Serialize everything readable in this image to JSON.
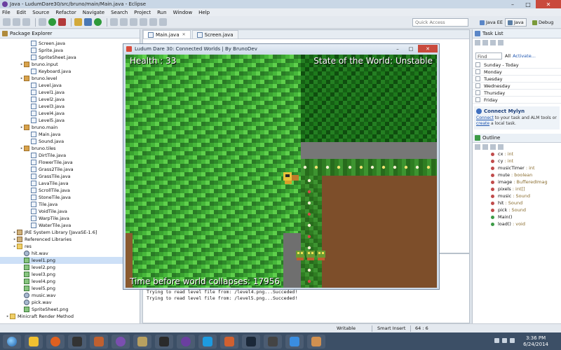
{
  "window": {
    "title": "Java - LudumDare30/src/bruno/main/Main.java - Eclipse"
  },
  "menu": [
    "File",
    "Edit",
    "Source",
    "Refactor",
    "Navigate",
    "Search",
    "Project",
    "Run",
    "Window",
    "Help"
  ],
  "toolbar": {
    "quick_access_placeholder": "Quick Access"
  },
  "perspectives": [
    {
      "label": "Java EE",
      "active": false
    },
    {
      "label": "Java",
      "active": true
    },
    {
      "label": "Debug",
      "active": false
    }
  ],
  "package_explorer": {
    "title": "Package Explorer",
    "items": [
      {
        "label": "Screen.java",
        "indent": 3,
        "icon": "java-file"
      },
      {
        "label": "Sprite.java",
        "indent": 3,
        "icon": "java-file"
      },
      {
        "label": "SpriteSheet.java",
        "indent": 3,
        "icon": "java-file"
      },
      {
        "label": "bruno.input",
        "indent": 2,
        "icon": "package"
      },
      {
        "label": "Keyboard.java",
        "indent": 3,
        "icon": "java-file"
      },
      {
        "label": "bruno.level",
        "indent": 2,
        "icon": "package"
      },
      {
        "label": "Level.java",
        "indent": 3,
        "icon": "java-file"
      },
      {
        "label": "Level1.java",
        "indent": 3,
        "icon": "java-file"
      },
      {
        "label": "Level2.java",
        "indent": 3,
        "icon": "java-file"
      },
      {
        "label": "Level3.java",
        "indent": 3,
        "icon": "java-file"
      },
      {
        "label": "Level4.java",
        "indent": 3,
        "icon": "java-file"
      },
      {
        "label": "Level5.java",
        "indent": 3,
        "icon": "java-file"
      },
      {
        "label": "bruno.main",
        "indent": 2,
        "icon": "package"
      },
      {
        "label": "Main.java",
        "indent": 3,
        "icon": "java-file"
      },
      {
        "label": "Sound.java",
        "indent": 3,
        "icon": "java-file"
      },
      {
        "label": "bruno.tiles",
        "indent": 2,
        "icon": "package"
      },
      {
        "label": "DirtTile.java",
        "indent": 3,
        "icon": "java-file"
      },
      {
        "label": "FlowerTile.java",
        "indent": 3,
        "icon": "java-file"
      },
      {
        "label": "Grass2Tile.java",
        "indent": 3,
        "icon": "java-file"
      },
      {
        "label": "GrassTile.java",
        "indent": 3,
        "icon": "java-file"
      },
      {
        "label": "LavaTile.java",
        "indent": 3,
        "icon": "java-file"
      },
      {
        "label": "ScrollTile.java",
        "indent": 3,
        "icon": "java-file"
      },
      {
        "label": "StoneTile.java",
        "indent": 3,
        "icon": "java-file"
      },
      {
        "label": "Tile.java",
        "indent": 3,
        "icon": "java-file"
      },
      {
        "label": "VoidTile.java",
        "indent": 3,
        "icon": "java-file"
      },
      {
        "label": "WarpTile.java",
        "indent": 3,
        "icon": "java-file"
      },
      {
        "label": "WaterTile.java",
        "indent": 3,
        "icon": "java-file"
      },
      {
        "label": "JRE System Library [JavaSE-1.6]",
        "indent": 1,
        "icon": "library"
      },
      {
        "label": "Referenced Libraries",
        "indent": 1,
        "icon": "library"
      },
      {
        "label": "res",
        "indent": 1,
        "icon": "folder"
      },
      {
        "label": "hit.wav",
        "indent": 2,
        "icon": "sound-file"
      },
      {
        "label": "level1.png",
        "indent": 2,
        "icon": "image-file"
      },
      {
        "label": "level2.png",
        "indent": 2,
        "icon": "image-file"
      },
      {
        "label": "level3.png",
        "indent": 2,
        "icon": "image-file"
      },
      {
        "label": "level4.png",
        "indent": 2,
        "icon": "image-file"
      },
      {
        "label": "level5.png",
        "indent": 2,
        "icon": "image-file"
      },
      {
        "label": "music.wav",
        "indent": 2,
        "icon": "sound-file"
      },
      {
        "label": "pick.wav",
        "indent": 2,
        "icon": "sound-file"
      },
      {
        "label": "SpriteSheet.png",
        "indent": 2,
        "icon": "image-file"
      },
      {
        "label": "Minicraft Render Method",
        "indent": 0,
        "icon": "project"
      }
    ]
  },
  "editor": {
    "tabs": [
      {
        "label": "Main.java",
        "active": true
      },
      {
        "label": "Screen.java",
        "active": false
      }
    ]
  },
  "console": {
    "lines": [
      "Trying to read level file from: /level4.png...Succeded!",
      "Trying to read level file from: /level5.png...Succeded!"
    ]
  },
  "task_list": {
    "title": "Task List",
    "find_placeholder": "Find",
    "all_label": "All",
    "activate_label": "Activate...",
    "days": [
      "Sunday - Today",
      "Monday",
      "Tuesday",
      "Wednesday",
      "Thursday",
      "Friday"
    ],
    "mylyn": {
      "title": "Connect Mylyn",
      "text_connect": "Connect",
      "text_mid": " to your task and ALM tools or ",
      "text_create": "create",
      "text_end": " a local task."
    }
  },
  "outline": {
    "title": "Outline",
    "items": [
      {
        "name": "cx",
        "type": ": int",
        "kind": "field"
      },
      {
        "name": "cy",
        "type": ": int",
        "kind": "field"
      },
      {
        "name": "musicTimer",
        "type": ": int",
        "kind": "field"
      },
      {
        "name": "mute",
        "type": ": boolean",
        "kind": "field"
      },
      {
        "name": "image",
        "type": ": BufferedImag",
        "kind": "field"
      },
      {
        "name": "pixels",
        "type": ": int[]",
        "kind": "field"
      },
      {
        "name": "music",
        "type": ": Sound",
        "kind": "field"
      },
      {
        "name": "hit",
        "type": ": Sound",
        "kind": "field"
      },
      {
        "name": "pick",
        "type": ": Sound",
        "kind": "field"
      },
      {
        "name": "Main()",
        "type": "",
        "kind": "method"
      },
      {
        "name": "load()",
        "type": ": void",
        "kind": "method"
      }
    ]
  },
  "status": {
    "writable": "Writable",
    "insert_mode": "Smart Insert",
    "position": "64 : 6"
  },
  "game_window": {
    "title": "Ludum Dare 30: Connected Worlds | By BrunoDev",
    "hud_health": "Health : 33",
    "hud_state": "State of the World: Unstable",
    "hud_timer": "Time before world collapses: 17956"
  },
  "taskbar": {
    "time": "3:36 PM",
    "date": "6/24/2014"
  },
  "colors": {
    "grass_light": "#46b83a",
    "grass_dark": "#2e8a2a",
    "dark_grass": "#155f14",
    "stone": "#777777",
    "dirt": "#7d4e2a",
    "flower_white": "#f4f0d0",
    "flower_red": "#d64848"
  }
}
